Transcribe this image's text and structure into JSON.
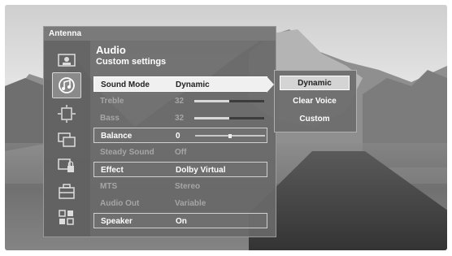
{
  "panel": {
    "title": "Antenna"
  },
  "header": {
    "title": "Audio",
    "subtitle": "Custom settings"
  },
  "categories": [
    {
      "icon": "picture-icon",
      "selected": false
    },
    {
      "icon": "audio-icon",
      "selected": true
    },
    {
      "icon": "channel-icon",
      "selected": false
    },
    {
      "icon": "display-icon",
      "selected": false
    },
    {
      "icon": "lock-icon",
      "selected": false
    },
    {
      "icon": "setup-icon",
      "selected": false
    },
    {
      "icon": "apps-icon",
      "selected": false
    }
  ],
  "settings": [
    {
      "label": "Sound Mode",
      "value": "Dynamic",
      "state": "active",
      "level": null
    },
    {
      "label": "Treble",
      "value": "32",
      "state": "dim",
      "level": 0.5
    },
    {
      "label": "Bass",
      "value": "32",
      "state": "dim",
      "level": 0.5
    },
    {
      "label": "Balance",
      "value": "0",
      "state": "boxed",
      "level": 0.5
    },
    {
      "label": "Steady Sound",
      "value": "Off",
      "state": "dim",
      "level": null
    },
    {
      "label": "Effect",
      "value": "Dolby Virtual",
      "state": "boxed",
      "level": null
    },
    {
      "label": "MTS",
      "value": "Stereo",
      "state": "dim",
      "level": null
    },
    {
      "label": "Audio Out",
      "value": "Variable",
      "state": "dim",
      "level": null
    },
    {
      "label": "Speaker",
      "value": "On",
      "state": "boxed",
      "level": null
    }
  ],
  "sound_mode_options": [
    {
      "label": "Dynamic",
      "selected": true
    },
    {
      "label": "Clear Voice",
      "selected": false
    },
    {
      "label": "Custom",
      "selected": false
    }
  ]
}
